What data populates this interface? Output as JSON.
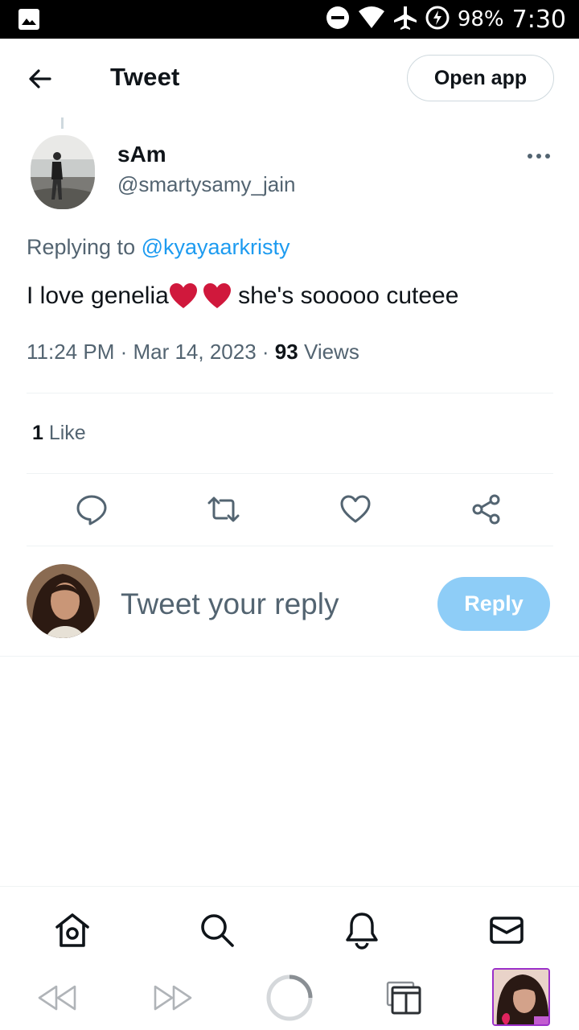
{
  "status_bar": {
    "battery": "98%",
    "time": "7:30"
  },
  "header": {
    "title": "Tweet",
    "open_app_label": "Open app"
  },
  "tweet": {
    "author_name": "sAm",
    "author_handle": "@smartysamy_jain",
    "replying_prefix": "Replying to ",
    "replying_to": "@kyayaarkristy",
    "text_before": "I love genelia",
    "text_after": " she's sooooo cuteee",
    "emojis": [
      "heart-emoji",
      "heart-emoji"
    ],
    "time": "11:24 PM",
    "date": "Mar 14, 2023",
    "views_count": "93",
    "views_label": " Views",
    "likes_count": "1",
    "likes_label": " Like"
  },
  "reply": {
    "placeholder": "Tweet your reply",
    "button_label": "Reply"
  },
  "colors": {
    "accent": "#1d9bf0",
    "reply_button_disabled": "#8ecdf7",
    "secondary_text": "#536471",
    "heart": "#d0183c"
  },
  "icons": {
    "actions": [
      "reply-icon",
      "retweet-icon",
      "like-icon",
      "share-icon"
    ],
    "nav": [
      "home-icon",
      "search-icon",
      "notifications-icon",
      "messages-icon"
    ],
    "browser": [
      "rewind-icon",
      "fast-forward-icon",
      "loading-spinner-icon",
      "tabs-icon"
    ]
  }
}
